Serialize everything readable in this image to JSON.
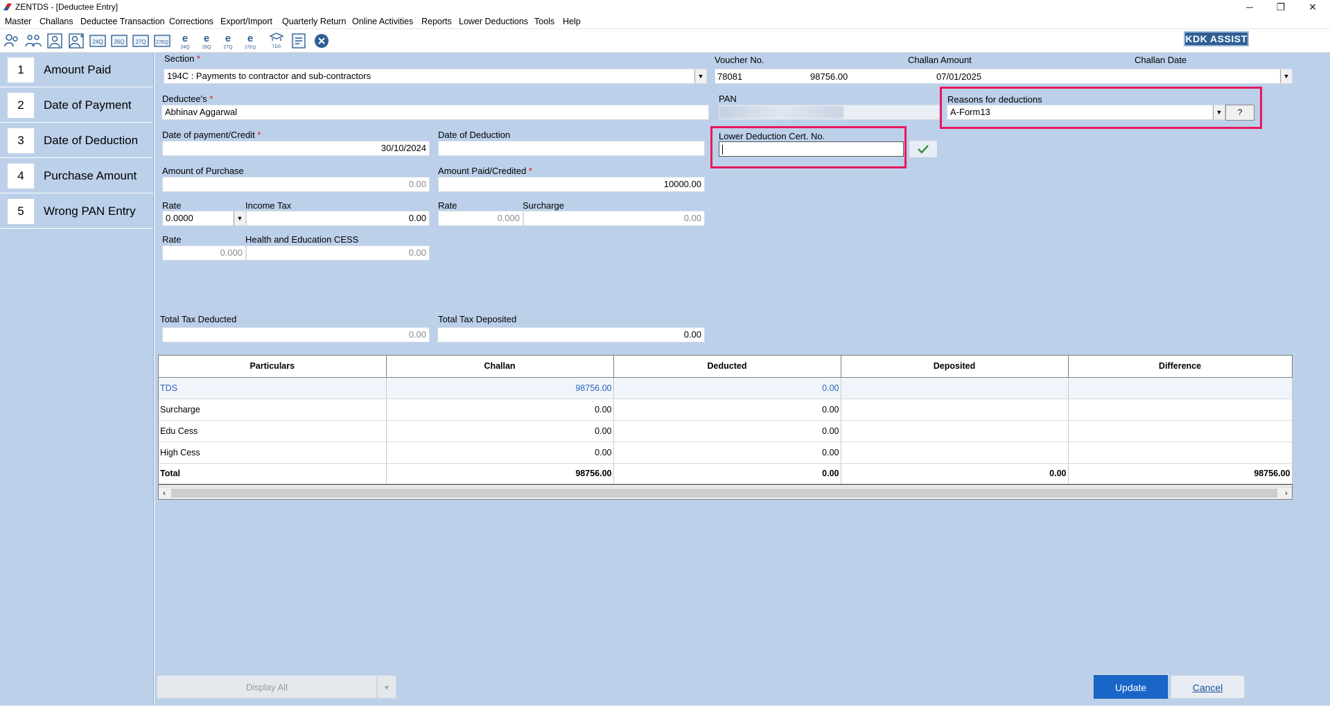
{
  "window": {
    "title": "ZENTDS - [Deductee Entry]",
    "minimize": "─",
    "restore": "❐",
    "close": "✕"
  },
  "menu": [
    "Master",
    "Challans",
    "Deductee Transaction",
    "Corrections",
    "Export/Import",
    "Quarterly Return",
    "Online Activities",
    "Reports",
    "Lower Deductions",
    "Tools",
    "Help"
  ],
  "toolbar": {
    "icons": [
      "deductor-icon",
      "deductees-icon",
      "user-icon",
      "user-add-icon",
      "form-24q-icon",
      "form-26q-icon",
      "form-27q-icon",
      "form-27eq-icon",
      "e-24q-icon",
      "e-26q-icon",
      "e-27q-icon",
      "e-27eq-icon",
      "tds-icon",
      "report-icon",
      "close-circle-icon"
    ],
    "tb_labels": [
      "",
      "",
      "",
      "",
      "24Q",
      "26Q",
      "27Q",
      "27EQ",
      "24Q",
      "26Q",
      "27Q",
      "27EQ",
      "TDS",
      "",
      ""
    ],
    "kdk_assist": "KDK ASSIST"
  },
  "sidebar": {
    "items": [
      {
        "num": "1",
        "label": "Amount Paid"
      },
      {
        "num": "2",
        "label": "Date of Payment"
      },
      {
        "num": "3",
        "label": "Date of Deduction"
      },
      {
        "num": "4",
        "label": "Purchase Amount"
      },
      {
        "num": "5",
        "label": "Wrong PAN Entry"
      }
    ]
  },
  "form": {
    "section_label": "Section",
    "required_mark": "*",
    "section_value": "194C : Payments to contractor and sub-contractors",
    "voucher_label": "Voucher No.",
    "challan_amount_label": "Challan Amount",
    "challan_date_label": "Challan Date",
    "voucher_value": "78081",
    "challan_amount_value": "98756.00",
    "challan_date_value": "07/01/2025",
    "deductee_label": "Deductee's",
    "deductee_value": "Abhinav Aggarwal",
    "pan_label": "PAN",
    "pan_value": "",
    "reasons_label": "Reasons for deductions",
    "reasons_value": "A-Form13",
    "reasons_help": "?",
    "date_payment_label": "Date of payment/Credit",
    "date_payment_value": "30/10/2024",
    "date_deduction_label": "Date of Deduction",
    "date_deduction_value": "",
    "lower_cert_label": "Lower Deduction Cert. No.",
    "lower_cert_value": "",
    "amount_purchase_label": "Amount of Purchase",
    "amount_purchase_value": "0.00",
    "amount_paid_label": "Amount Paid/Credited",
    "amount_paid_value": "10000.00",
    "rate_label": "Rate",
    "income_tax_label": "Income Tax",
    "rate_value": "0.0000",
    "income_tax_value": "0.00",
    "surcharge_rate_label": "Rate",
    "surcharge_label": "Surcharge",
    "surcharge_rate_value": "0.000",
    "surcharge_value": "0.00",
    "cess_rate_label": "Rate",
    "cess_label": "Health and Education CESS",
    "cess_rate_value": "0.000",
    "cess_value": "0.00",
    "total_deducted_label": "Total Tax Deducted",
    "total_deducted_value": "0.00",
    "total_deposited_label": "Total Tax Deposited",
    "total_deposited_value": "0.00"
  },
  "grid": {
    "headers": [
      "Particulars",
      "Challan",
      "Deducted",
      "Deposited",
      "Difference"
    ],
    "rows": [
      [
        "TDS",
        "98756.00",
        "0.00",
        "",
        ""
      ],
      [
        "Surcharge",
        "0.00",
        "0.00",
        "",
        ""
      ],
      [
        "Edu Cess",
        "0.00",
        "0.00",
        "",
        ""
      ],
      [
        "High Cess",
        "0.00",
        "0.00",
        "",
        ""
      ],
      [
        "Total",
        "98756.00",
        "0.00",
        "0.00",
        "98756.00"
      ]
    ]
  },
  "footer": {
    "display_all": "Display All",
    "update": "Update",
    "cancel": "Cancel"
  },
  "colors": {
    "panel": "#bcd0ea",
    "highlight": "#e8175d",
    "primary": "#1a66c8",
    "kdk": "#2d5f94"
  }
}
